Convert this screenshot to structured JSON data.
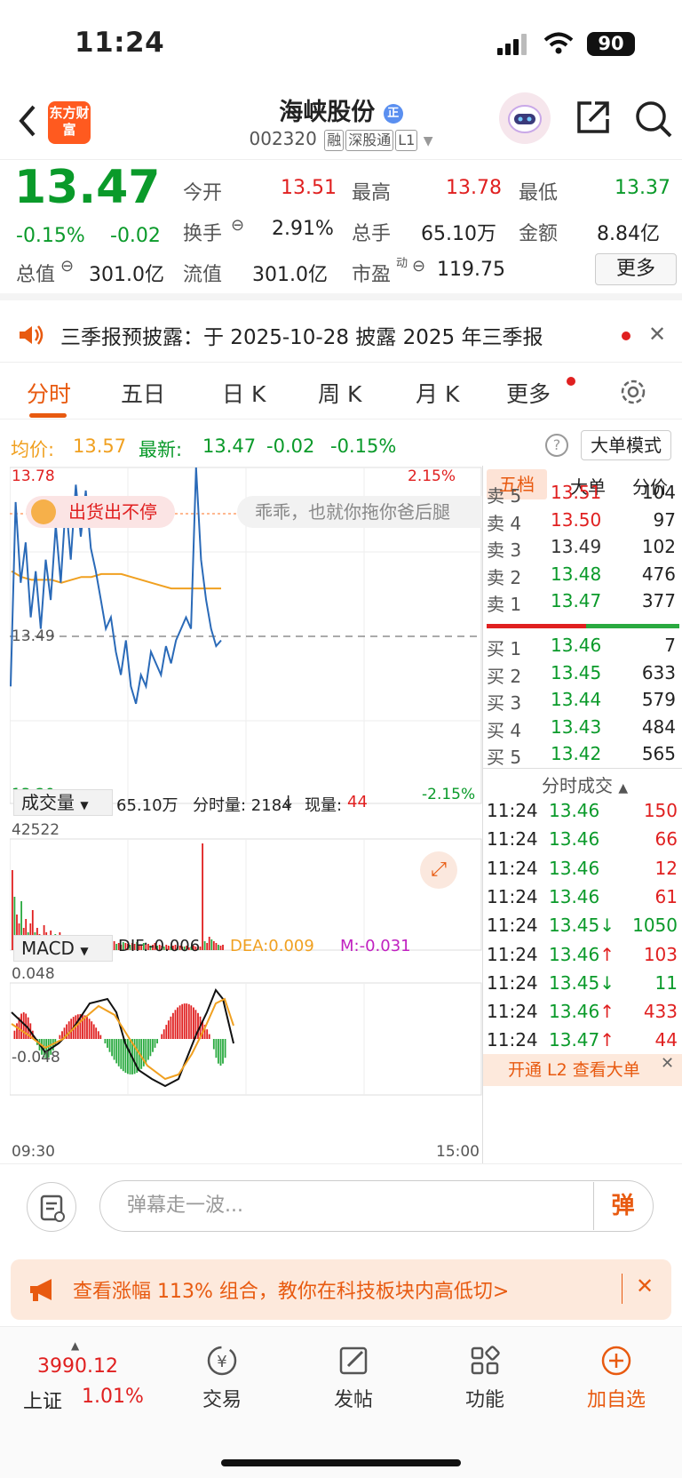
{
  "status": {
    "time": "11:24",
    "battery": "90"
  },
  "header": {
    "logo": "东方财富",
    "title": "海峡股份",
    "code": "002320",
    "tags": [
      "融",
      "深股通",
      "L1"
    ]
  },
  "quote": {
    "price": "13.47",
    "pct": "-0.15%",
    "chg": "-0.02",
    "labels": {
      "open": "今开",
      "high": "最高",
      "low": "最低",
      "turnover": "换手",
      "vol": "总手",
      "amount": "金额",
      "mktcap": "总值",
      "float": "流值",
      "pe": "市盈"
    },
    "open": "13.51",
    "high": "13.78",
    "low": "13.37",
    "turnover": "2.91%",
    "vol": "65.10万",
    "amount": "8.84亿",
    "mktcap": "301.0亿",
    "float": "301.0亿",
    "pe": "119.75",
    "pe_sup": "动",
    "more": "更多"
  },
  "notice": {
    "text": "三季报预披露：于 2025-10-28 披露 2025 年三季报"
  },
  "tabs": [
    "分时",
    "五日",
    "日 K",
    "周 K",
    "月 K",
    "更多"
  ],
  "info": {
    "avg_label": "均价:",
    "avg": "13.57",
    "latest_label": "最新:",
    "latest": "13.47",
    "chg": "-0.02",
    "pct": "-0.15%",
    "mode": "大单模式"
  },
  "chart": {
    "ymax": "13.78",
    "ymin": "13.20",
    "pmax": "2.15%",
    "pmin": "-2.15%",
    "mid": "13.49",
    "danmu1": "出货出不停",
    "danmu2": "乖乖，也就你拖你爸后腿",
    "vol_selector": "成交量",
    "vol_total": "65.10万",
    "vol_info": "分时量: 2184",
    "vol_now_label": "现量:",
    "vol_now": "44",
    "vol_max": "42522",
    "macd_selector": "MACD",
    "dif": "DIF:-0.006",
    "dea": "DEA:0.009",
    "m": "M:-0.031",
    "macd_max": "0.048",
    "macd_min": "-0.048",
    "t_start": "09:30",
    "t_end": "15:00"
  },
  "chart_data": {
    "type": "line",
    "title": "",
    "series": [
      {
        "name": "",
        "values": [
          13.4,
          13.72,
          13.58,
          13.65,
          13.52,
          13.6,
          13.5,
          13.62,
          13.55,
          13.68,
          13.58,
          13.72,
          13.62,
          13.75,
          13.66,
          13.74,
          13.64,
          13.6,
          13.55,
          13.5,
          13.52,
          13.46,
          13.42,
          13.48,
          13.4,
          13.37,
          13.42,
          13.4,
          13.46,
          13.44,
          13.42,
          13.47,
          13.44,
          13.48,
          13.5,
          13.52,
          13.5,
          13.78,
          13.62,
          13.55,
          13.5,
          13.47,
          13.48
        ]
      },
      {
        "name": "",
        "values": [
          13.6,
          13.59,
          13.585,
          13.585,
          13.585,
          13.58,
          13.585,
          13.59,
          13.59,
          13.595,
          13.595,
          13.595,
          13.59,
          13.585,
          13.58,
          13.575,
          13.57,
          13.57,
          13.57,
          13.57,
          13.57,
          13.57
        ]
      }
    ],
    "ylim": [
      13.2,
      13.78
    ]
  },
  "book": {
    "tabs": [
      "五档",
      "大单",
      "分价"
    ],
    "asks": [
      {
        "l": "卖 5",
        "p": "13.51",
        "v": "104"
      },
      {
        "l": "卖 4",
        "p": "13.50",
        "v": "97"
      },
      {
        "l": "卖 3",
        "p": "13.49",
        "v": "102"
      },
      {
        "l": "卖 2",
        "p": "13.48",
        "v": "476"
      },
      {
        "l": "卖 1",
        "p": "13.47",
        "v": "377"
      }
    ],
    "bids": [
      {
        "l": "买 1",
        "p": "13.46",
        "v": "7"
      },
      {
        "l": "买 2",
        "p": "13.45",
        "v": "633"
      },
      {
        "l": "买 3",
        "p": "13.44",
        "v": "579"
      },
      {
        "l": "买 4",
        "p": "13.43",
        "v": "484"
      },
      {
        "l": "买 5",
        "p": "13.42",
        "v": "565"
      }
    ],
    "trades_title": "分时成交",
    "trades": [
      {
        "t": "11:24",
        "p": "13.46",
        "v": "150"
      },
      {
        "t": "11:24",
        "p": "13.46",
        "v": "66"
      },
      {
        "t": "11:24",
        "p": "13.46",
        "v": "12"
      },
      {
        "t": "11:24",
        "p": "13.46",
        "v": "61"
      },
      {
        "t": "11:24",
        "p": "13.45↓",
        "v": "1050"
      },
      {
        "t": "11:24",
        "p": "13.46↑",
        "v": "103"
      },
      {
        "t": "11:24",
        "p": "13.45↓",
        "v": "11"
      },
      {
        "t": "11:24",
        "p": "13.46↑",
        "v": "433"
      },
      {
        "t": "11:24",
        "p": "13.47↑",
        "v": "44"
      }
    ],
    "l2": "开通 L2 查看大单"
  },
  "danmu": {
    "placeholder": "弹幕走一波...",
    "btn": "弹"
  },
  "banner": {
    "text": "查看涨幅 113% 组合，教你在科技板块内高低切>"
  },
  "nav": {
    "index_value": "3990.12",
    "index_name": "上证",
    "index_pct": "1.01%",
    "items": [
      "交易",
      "发帖",
      "功能",
      "加自选"
    ]
  }
}
